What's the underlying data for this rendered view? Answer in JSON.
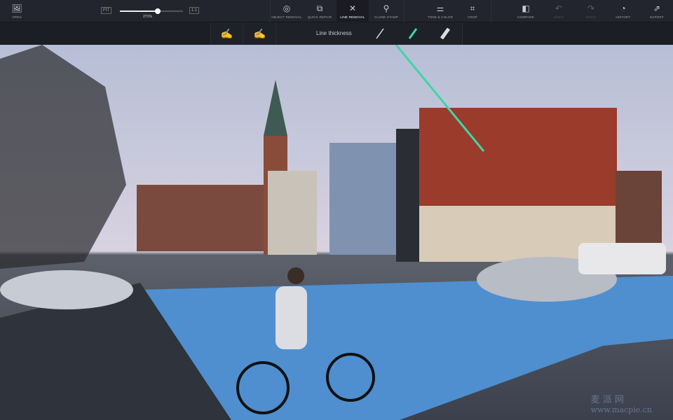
{
  "toolbar": {
    "open": {
      "label": "OPEN",
      "icon": "image-icon"
    },
    "zoom": {
      "fit_label": "FIT",
      "one_label": "1:1",
      "value": "271%",
      "level": 0.6
    },
    "tools": [
      {
        "label": "OBJECT REMOVAL",
        "icon": "object-removal-icon"
      },
      {
        "label": "QUICK REPAIR",
        "icon": "bandage-icon"
      },
      {
        "label": "LINE REMOVAL",
        "icon": "line-removal-icon",
        "active": true
      },
      {
        "label": "CLONE STAMP",
        "icon": "stamp-icon"
      },
      {
        "label": "TONE & COLOR",
        "icon": "sliders-icon"
      },
      {
        "label": "CROP",
        "icon": "crop-icon"
      }
    ],
    "compare": "COMPARE",
    "undo": "UNDO",
    "redo": "REDO",
    "history": "HISTORY",
    "export": "EXPORT"
  },
  "subtoolbar": {
    "line_thickness_label": "Line thickness",
    "selected_thickness": 1,
    "accent": "#3fd6a5"
  },
  "watermark": {
    "text1": "麦 派 网",
    "text2": "www.macpie.cn"
  }
}
